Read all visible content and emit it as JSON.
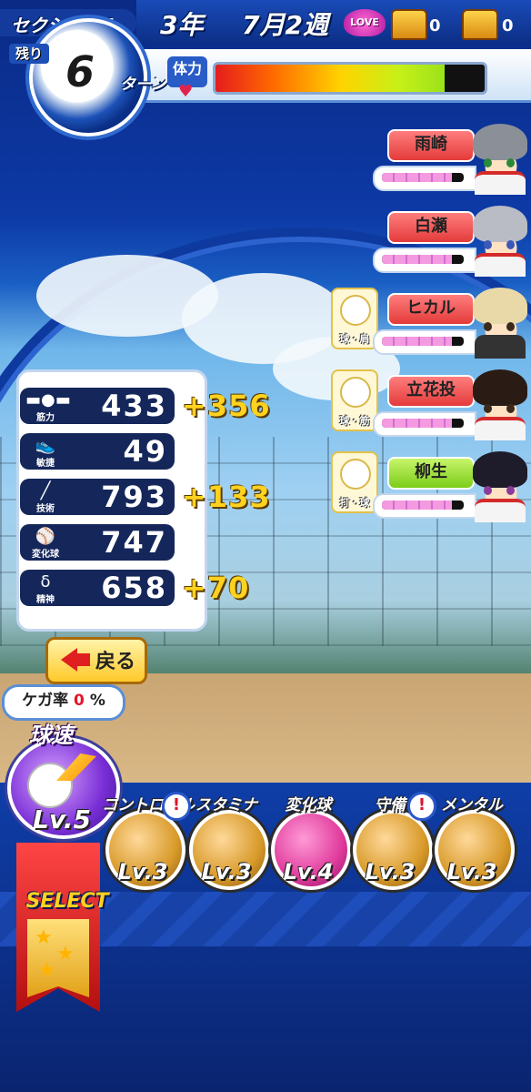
{
  "header": {
    "section": "セクション4",
    "remaining_label": "残り",
    "turns_left": "6",
    "turn_unit": "ターン",
    "year": "3年",
    "week": "7月2週",
    "love_label": "LOVE",
    "chest_left_count": "0",
    "chest_right_count": "0",
    "stamina_label": "体力",
    "stamina_level": 0.85
  },
  "partners": [
    {
      "name": "雨崎",
      "tag_color": "red",
      "gauge": 0.85,
      "skill": ""
    },
    {
      "name": "白瀬",
      "tag_color": "red",
      "gauge": 0.85,
      "skill": ""
    },
    {
      "name": "ヒカル",
      "tag_color": "red",
      "gauge": 0.85,
      "skill": "球・肩"
    },
    {
      "name": "立花投",
      "tag_color": "red",
      "gauge": 0.85,
      "skill": "球・筋"
    },
    {
      "name": "柳生",
      "tag_color": "green",
      "gauge": 0.85,
      "skill": "打・球"
    }
  ],
  "stats": [
    {
      "label": "筋力",
      "icon": "dumbbell-icon",
      "value": "433",
      "bonus": "+356"
    },
    {
      "label": "敏捷",
      "icon": "spike-shoe-icon",
      "value": "49",
      "bonus": ""
    },
    {
      "label": "技術",
      "icon": "bat-icon",
      "value": "793",
      "bonus": "+133"
    },
    {
      "label": "変化球",
      "icon": "curveball-icon",
      "value": "747",
      "bonus": ""
    },
    {
      "label": "精神",
      "icon": "spirit-icon",
      "value": "658",
      "bonus": "+70"
    }
  ],
  "back_label": "戻る",
  "injury": {
    "label": "ケガ率",
    "value": "0",
    "unit": "%"
  },
  "selected_skill": {
    "title": "球速",
    "level": "Lv.5",
    "icon": "fastball-icon"
  },
  "skills": [
    {
      "title": "コントロール",
      "level": "Lv.3",
      "icon": "crosshair-ball-icon",
      "alert": true,
      "color": "#d89a2a"
    },
    {
      "title": "スタミナ",
      "level": "Lv.3",
      "icon": "tire-icon",
      "alert": false,
      "color": "#d89a2a"
    },
    {
      "title": "変化球",
      "level": "Lv.4",
      "icon": "curve-arrows-ball-icon",
      "alert": false,
      "color": "#e03b9c"
    },
    {
      "title": "守備",
      "level": "Lv.3",
      "icon": "glove-icon",
      "alert": true,
      "color": "#d89a2a"
    },
    {
      "title": "メンタル",
      "level": "Lv.3",
      "icon": "cloud-ball-icon",
      "alert": false,
      "color": "#d89a2a"
    }
  ],
  "select_label": "SELECT",
  "alert_mark": "!",
  "colors": {
    "accent_blue": "#0d3aa6",
    "bonus_yellow": "#ffd21f",
    "danger_red": "#e6142b"
  }
}
